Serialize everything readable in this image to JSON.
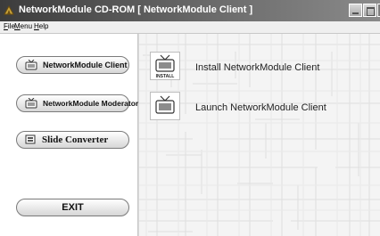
{
  "window": {
    "title": "NetworkModule CD-ROM   [ NetworkModule Client ]"
  },
  "menu": {
    "items": [
      "File",
      "Menu",
      "Help"
    ]
  },
  "sidebar": {
    "buttons": [
      {
        "label": "NetworkModule Client",
        "icon": "tv-icon"
      },
      {
        "label": "NetworkModule Moderator",
        "icon": "tv-icon"
      },
      {
        "label": "Slide Converter",
        "icon": "slide-icon"
      },
      {
        "label": "EXIT"
      }
    ]
  },
  "main": {
    "actions": [
      {
        "label": "Install NetworkModule Client",
        "icon": "install-tv-icon",
        "icon_text": "INSTALL"
      },
      {
        "label": "Launch NetworkModule Client",
        "icon": "tv-icon"
      }
    ]
  }
}
